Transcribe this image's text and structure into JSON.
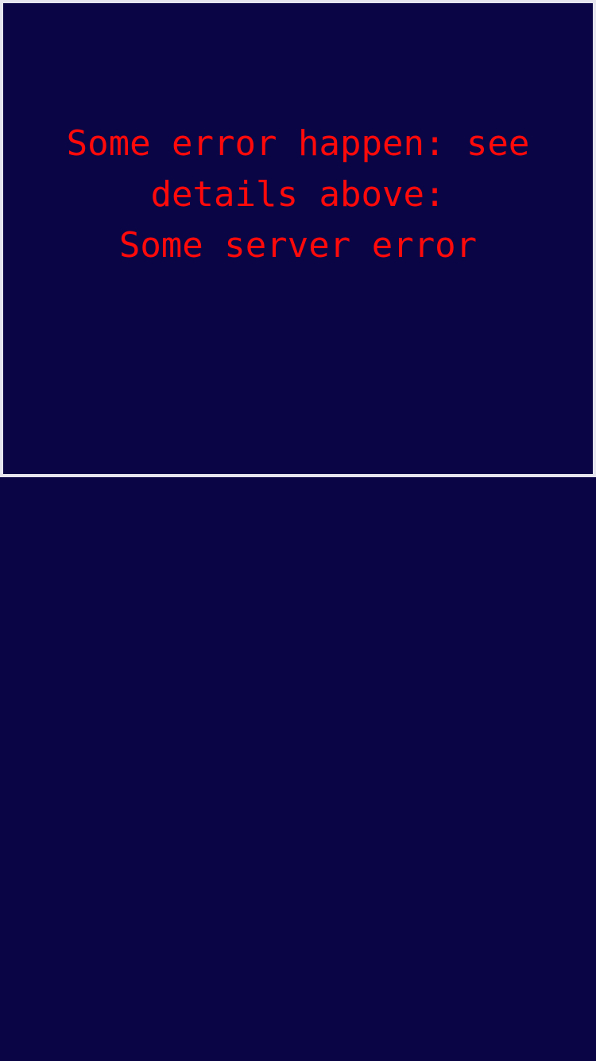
{
  "error": {
    "line1": "Some error happen: see",
    "line2": "details above:",
    "line3": "Some server error"
  },
  "colors": {
    "background": "#0a0646",
    "border": "#e6e6ee",
    "error_text": "#ff0a0a"
  }
}
